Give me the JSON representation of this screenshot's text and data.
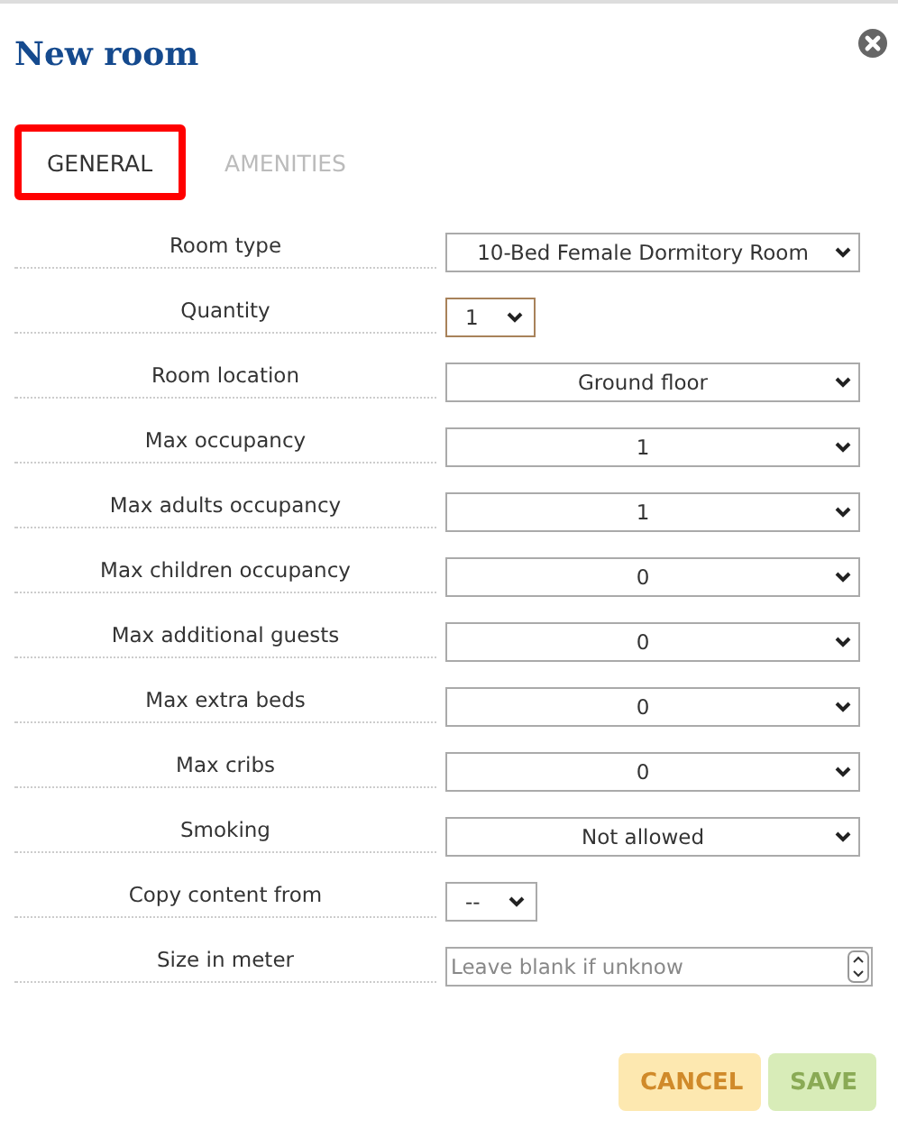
{
  "dialog": {
    "title": "New room"
  },
  "tabs": [
    {
      "label": "GENERAL",
      "selected": true
    },
    {
      "label": "AMENITIES",
      "selected": false
    }
  ],
  "fields": [
    {
      "label": "Room type",
      "kind": "select",
      "value": "10-Bed Female Dormitory Room",
      "focused": false
    },
    {
      "label": "Quantity",
      "kind": "compact-select",
      "value": "1",
      "focused": true
    },
    {
      "label": "Room location",
      "kind": "select",
      "value": "Ground floor",
      "focused": false
    },
    {
      "label": "Max occupancy",
      "kind": "select",
      "value": "1",
      "focused": false
    },
    {
      "label": "Max adults occupancy",
      "kind": "select",
      "value": "1",
      "focused": false
    },
    {
      "label": "Max children occupancy",
      "kind": "select",
      "value": "0",
      "focused": false
    },
    {
      "label": "Max additional guests",
      "kind": "select",
      "value": "0",
      "focused": false
    },
    {
      "label": "Max extra beds",
      "kind": "select",
      "value": "0",
      "focused": false
    },
    {
      "label": "Max cribs",
      "kind": "select",
      "value": "0",
      "focused": false
    },
    {
      "label": "Smoking",
      "kind": "select",
      "value": "Not allowed",
      "focused": false
    },
    {
      "label": "Copy content from",
      "kind": "compact-select",
      "value": "--",
      "focused": false
    },
    {
      "label": "Size in meter",
      "kind": "number",
      "placeholder": "Leave blank if unknow"
    }
  ],
  "buttons": [
    {
      "label": "CANCEL",
      "kind": "cancel"
    },
    {
      "label": "SAVE",
      "kind": "save"
    }
  ]
}
